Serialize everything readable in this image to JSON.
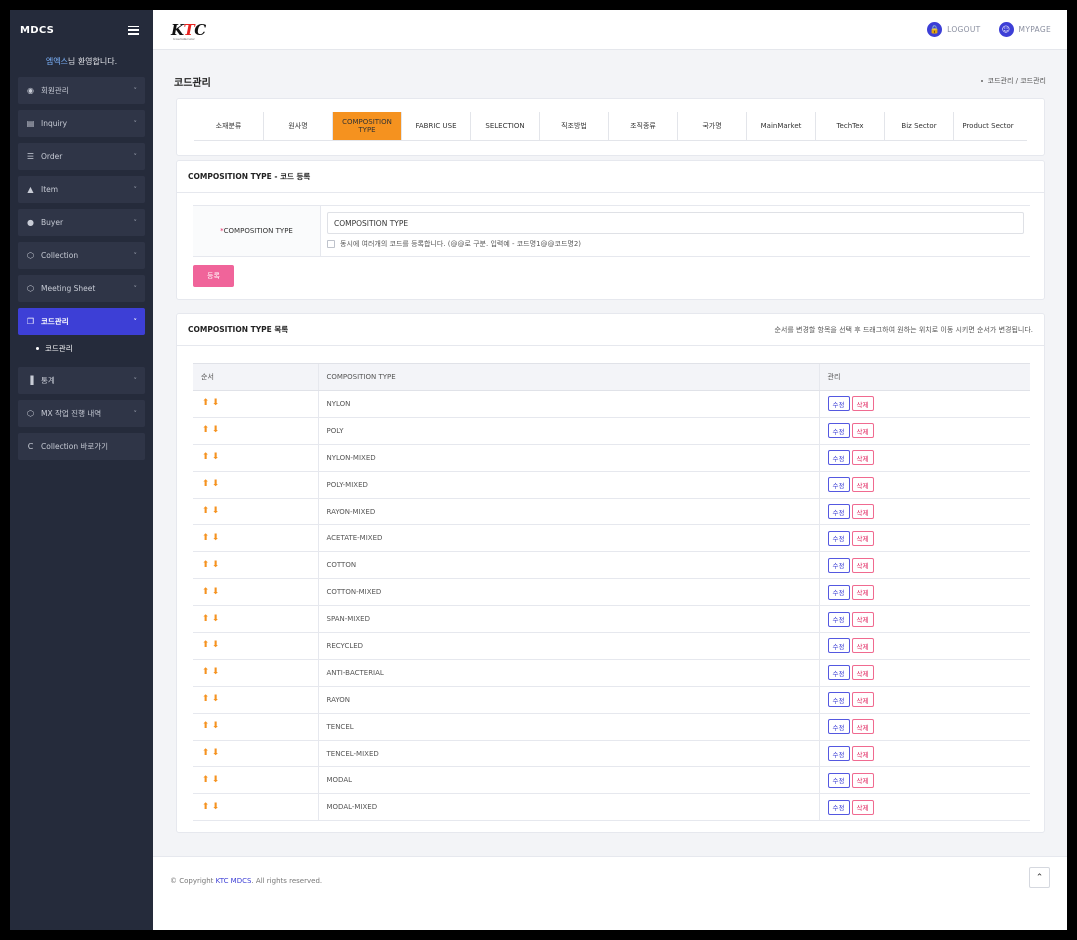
{
  "sidebar": {
    "brand": "MDCS",
    "welcome_name": "엠엑스",
    "welcome_suffix": "님 환영합니다.",
    "items": [
      {
        "label": "회원관리",
        "icon": "user-circle-icon"
      },
      {
        "label": "Inquiry",
        "icon": "clipboard-icon"
      },
      {
        "label": "Order",
        "icon": "list-icon"
      },
      {
        "label": "Item",
        "icon": "tshirt-icon"
      },
      {
        "label": "Buyer",
        "icon": "person-icon"
      },
      {
        "label": "Collection",
        "icon": "box-icon"
      },
      {
        "label": "Meeting Sheet",
        "icon": "box-icon"
      },
      {
        "label": "코드관리",
        "icon": "copy-icon"
      },
      {
        "label": "통계",
        "icon": "bar-chart-icon"
      },
      {
        "label": "MX 작업 진행 내역",
        "icon": "box-icon"
      },
      {
        "label": "Collection 바로가기",
        "icon": "c-letter-icon"
      }
    ],
    "active_sub": "코드관리"
  },
  "topbar": {
    "logo": "KTC",
    "logo_sub": "Korea Textile Center",
    "logout": "LOGOUT",
    "mypage": "MYPAGE"
  },
  "page": {
    "title": "코드관리",
    "breadcrumb": "코드관리 / 코드관리"
  },
  "tabs": [
    "소재분류",
    "원사명",
    "COMPOSITION TYPE",
    "FABRIC USE",
    "SELECTION",
    "직조방법",
    "조직종류",
    "국가명",
    "MainMarket",
    "TechTex",
    "Biz Sector",
    "Product Sector"
  ],
  "active_tab": "COMPOSITION TYPE",
  "register": {
    "title": "COMPOSITION TYPE - 코드 등록",
    "field_label": "COMPOSITION TYPE",
    "required_mark": "*",
    "input_value": "COMPOSITION TYPE",
    "checkbox_label": "동시에 여러개의 코드를 등록합니다. (@@로 구분. 입력예 - 코드명1@@코드명2)",
    "submit": "등록"
  },
  "list": {
    "title": "COMPOSITION TYPE 목록",
    "note": "순서를 변경할 항목을 선택 후 드래그하여 원하는 위치로 이동 시키면 순서가 변경됩니다.",
    "columns": [
      "순서",
      "COMPOSITION TYPE",
      "관리"
    ],
    "edit_label": "수정",
    "delete_label": "삭제",
    "rows": [
      "NYLON",
      "POLY",
      "NYLON-MIXED",
      "POLY-MIXED",
      "RAYON-MIXED",
      "ACETATE-MIXED",
      "COTTON",
      "COTTON-MIXED",
      "SPAN-MIXED",
      "RECYCLED",
      "ANTI-BACTERIAL",
      "RAYON",
      "TENCEL",
      "TENCEL-MIXED",
      "MODAL",
      "MODAL-MIXED"
    ]
  },
  "footer": {
    "copy_prefix": "© Copyright ",
    "copy_brand": "KTC MDCS",
    "copy_suffix": ". All rights reserved."
  },
  "colors": {
    "sidebar_bg": "#252b3b",
    "accent": "#3d3fd6",
    "active_tab": "#f5921f",
    "submit": "#f0649a"
  }
}
